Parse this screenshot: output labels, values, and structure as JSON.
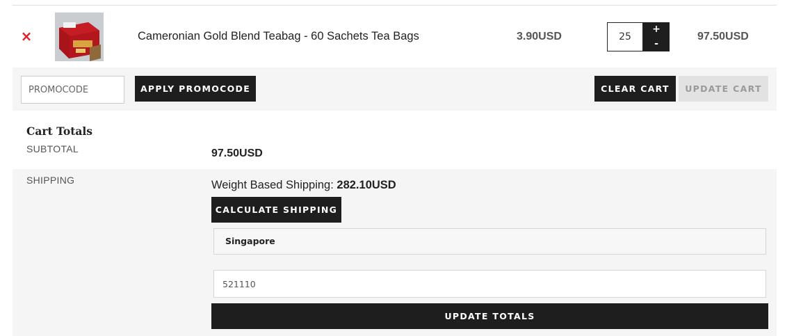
{
  "cart_item": {
    "remove_symbol": "×",
    "product_name": "Cameronian Gold Blend Teabag - 60 Sachets Tea Bags",
    "unit_price": "3.90USD",
    "quantity": "25",
    "qty_plus": "+",
    "qty_minus": "-",
    "line_total": "97.50USD"
  },
  "actions": {
    "promocode_placeholder": "PROMOCODE",
    "apply_label": "APPLY PROMOCODE",
    "clear_label": "CLEAR CART",
    "update_label": "UPDATE CART"
  },
  "totals": {
    "title": "Cart Totals",
    "subtotal_label": "SUBTOTAL",
    "subtotal_value": "97.50USD",
    "shipping_label": "SHIPPING",
    "shipping_method": "Weight Based Shipping:",
    "shipping_cost": "282.10USD",
    "calculate_label": "CALCULATE SHIPPING",
    "country": "Singapore",
    "postcode": "521110",
    "update_totals_label": "UPDATE TOTALS"
  },
  "colors": {
    "accent_dark": "#1e1e1e",
    "remove_red": "#e0202a",
    "panel_gray": "#f5f5f5"
  }
}
